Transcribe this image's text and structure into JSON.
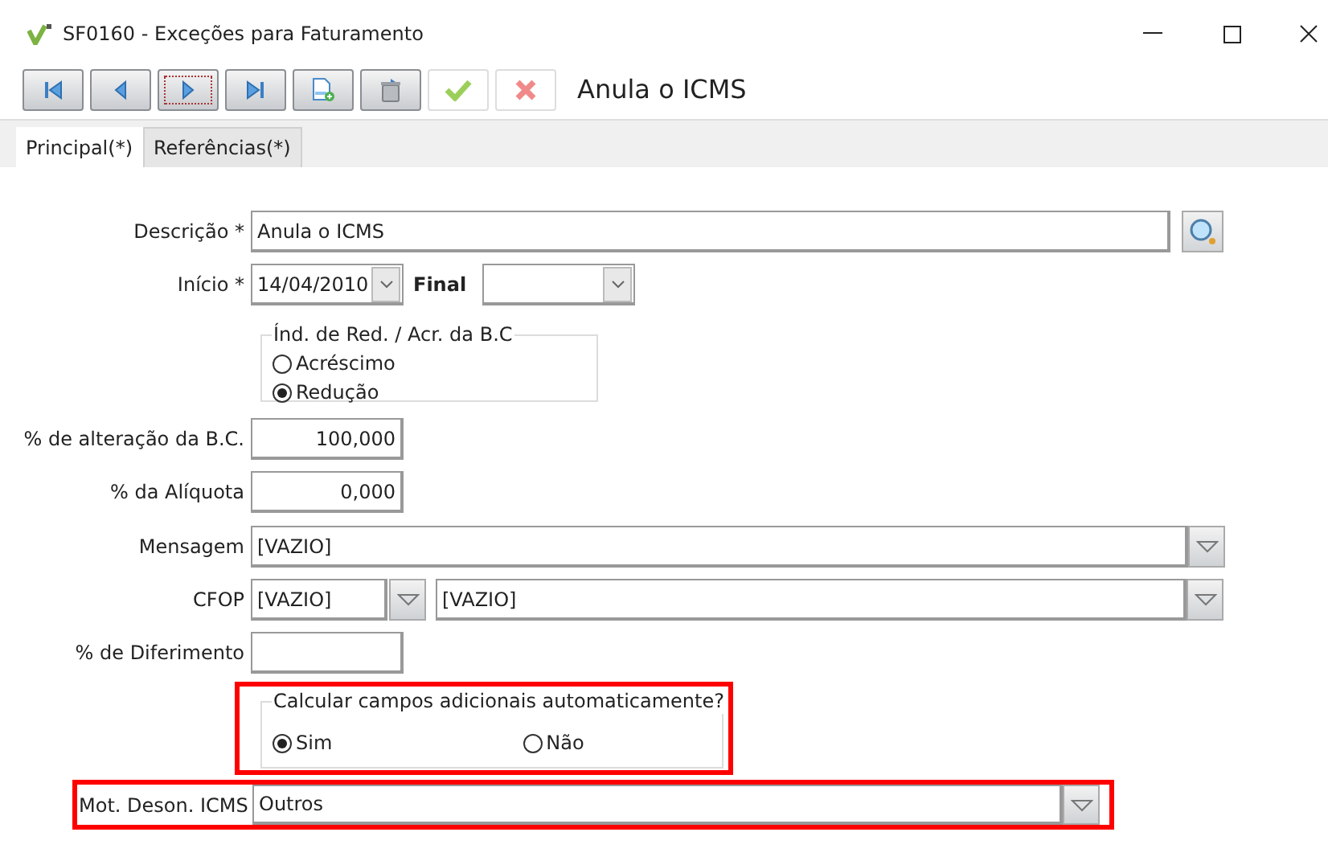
{
  "window": {
    "title": "SF0160 - Exceções para Faturamento"
  },
  "toolbar": {
    "buttons": [
      {
        "kind": "first",
        "focused": false,
        "disabled": false
      },
      {
        "kind": "previous",
        "focused": false,
        "disabled": false
      },
      {
        "kind": "next",
        "focused": true,
        "disabled": false
      },
      {
        "kind": "last",
        "focused": false,
        "disabled": false
      },
      {
        "kind": "new",
        "focused": false,
        "disabled": false
      },
      {
        "kind": "delete",
        "focused": false,
        "disabled": false
      },
      {
        "kind": "confirm",
        "focused": false,
        "disabled": true
      },
      {
        "kind": "cancel",
        "focused": false,
        "disabled": true
      }
    ],
    "record_title": "Anula o ICMS"
  },
  "tabs": [
    {
      "label": "Principal(*)",
      "selected": true
    },
    {
      "label": "Referências(*)",
      "selected": false
    }
  ],
  "form": {
    "descricao": {
      "label": "Descrição *",
      "value": "Anula o ICMS"
    },
    "inicio": {
      "label": "Início *",
      "value": "14/04/2010"
    },
    "final": {
      "label": "Final"
    },
    "indice_group": {
      "legend": "Índ. de Red. / Acr. da B.C",
      "options": [
        {
          "label": "Acréscimo",
          "selected": false
        },
        {
          "label": "Redução",
          "selected": true
        }
      ]
    },
    "alteracao_bc": {
      "label": "% de alteração da B.C.",
      "value": "100,000"
    },
    "aliquota": {
      "label": "% da Alíquota",
      "value": "0,000"
    },
    "mensagem": {
      "label": "Mensagem",
      "value": "[VAZIO]"
    },
    "cfop": {
      "label": "CFOP",
      "code": "[VAZIO]",
      "description": "[VAZIO]"
    },
    "diferimento": {
      "label": "% de Diferimento"
    },
    "calcular_group": {
      "legend": "Calcular campos adicionais automaticamente?",
      "highlighted": true,
      "options": [
        {
          "label": "Sim",
          "selected": true
        },
        {
          "label": "Não",
          "selected": false
        }
      ]
    },
    "mot_deson": {
      "label": "Mot. Deson. ICMS",
      "value": "Outros",
      "highlighted": true
    }
  }
}
